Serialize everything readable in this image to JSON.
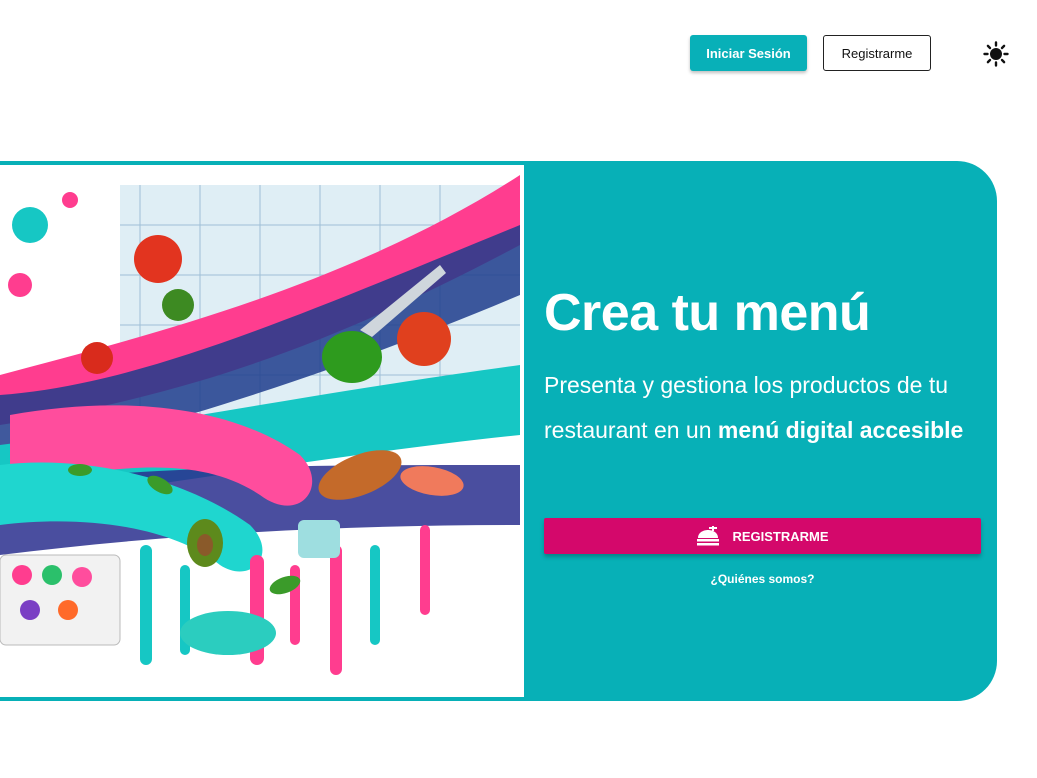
{
  "header": {
    "login_label": "Iniciar Sesión",
    "register_label": "Registrarme",
    "theme_icon": "sun-icon"
  },
  "hero": {
    "title": "Crea tu menú",
    "description_line": "Presenta y gestiona los productos de tu restaurant en un",
    "description_bold": "menú digital accesible",
    "cta_label": "REGISTRARME",
    "cta_icon": "food-tray-icon",
    "about_link": "¿Quiénes somos?",
    "image_icon": "food-splash-illustration"
  },
  "colors": {
    "accent": "#07b0b7",
    "cta": "#d4086b",
    "background": "#ffffff"
  }
}
